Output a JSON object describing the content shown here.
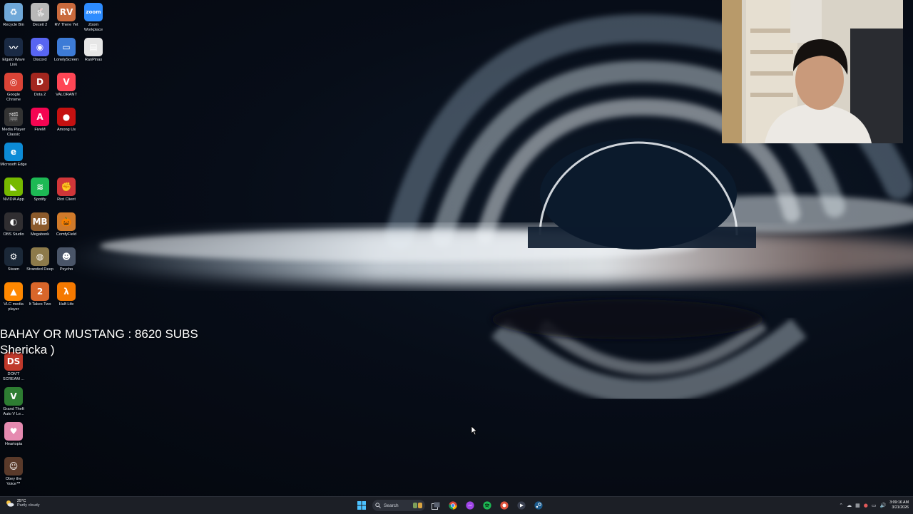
{
  "desktop": {
    "icons": [
      {
        "label": "Recycle Bin",
        "icon": "recycle-bin-icon",
        "color": "#6fa8d8",
        "glyph": "♻"
      },
      {
        "label": "Deceit 2",
        "icon": "deceit-icon",
        "color": "#b8b8b8",
        "glyph": "🐇"
      },
      {
        "label": "RV There Yet",
        "icon": "rv-there-yet-icon",
        "color": "#c96a3d",
        "glyph": "RV"
      },
      {
        "label": "Zoom Workplace",
        "icon": "zoom-icon",
        "color": "#2d8cff",
        "glyph": "zoom"
      },
      {
        "label": "Elgato Wave Link",
        "icon": "elgato-wave-link-icon",
        "color": "#1a2a44",
        "glyph": "〰"
      },
      {
        "label": "Discord",
        "icon": "discord-icon",
        "color": "#5865f2",
        "glyph": "◉"
      },
      {
        "label": "LonelyScreen",
        "icon": "lonelyscreen-icon",
        "color": "#3d7bd6",
        "glyph": "▭"
      },
      {
        "label": "RanPinas",
        "icon": "file-icon",
        "color": "#e6e6e6",
        "glyph": "▤"
      },
      {
        "label": "Google Chrome",
        "icon": "chrome-icon",
        "color": "#db4437",
        "glyph": "◎"
      },
      {
        "label": "Dota 2",
        "icon": "dota2-icon",
        "color": "#a3271f",
        "glyph": "D"
      },
      {
        "label": "VALORANT",
        "icon": "valorant-icon",
        "color": "#ff4655",
        "glyph": "V"
      },
      {
        "label": "Media Player Classic",
        "icon": "media-player-classic-icon",
        "color": "#333",
        "glyph": "🎬"
      },
      {
        "label": "FiveM",
        "icon": "fivem-icon",
        "color": "#f40552",
        "glyph": "A"
      },
      {
        "label": "Among Us",
        "icon": "among-us-icon",
        "color": "#c51111",
        "glyph": "●"
      },
      {
        "label": "Microsoft Edge",
        "icon": "edge-icon",
        "color": "#0c8bd6",
        "glyph": "e"
      },
      {
        "label": "NVIDIA App",
        "icon": "nvidia-icon",
        "color": "#76b900",
        "glyph": "◣"
      },
      {
        "label": "Spotify",
        "icon": "spotify-icon",
        "color": "#1db954",
        "glyph": "≋"
      },
      {
        "label": "Riot Client",
        "icon": "riot-client-icon",
        "color": "#d13639",
        "glyph": "✊"
      },
      {
        "label": "OBS Studio",
        "icon": "obs-icon",
        "color": "#302e31",
        "glyph": "◐"
      },
      {
        "label": "Megabonk",
        "icon": "megabonk-icon",
        "color": "#8b5a2b",
        "glyph": "MB"
      },
      {
        "label": "ComfyField",
        "icon": "comfyfield-icon",
        "color": "#d07a2a",
        "glyph": "🎃"
      },
      {
        "label": "Steam",
        "icon": "steam-icon",
        "color": "#1b2838",
        "glyph": "⚙"
      },
      {
        "label": "Stranded Deep",
        "icon": "stranded-deep-icon",
        "color": "#8d7a4a",
        "glyph": "◍"
      },
      {
        "label": "Psycho",
        "icon": "psycho-icon",
        "color": "#4a5568",
        "glyph": "☻"
      },
      {
        "label": "VLC media player",
        "icon": "vlc-icon",
        "color": "#ff8800",
        "glyph": "▲"
      },
      {
        "label": "It Takes Two",
        "icon": "it-takes-two-icon",
        "color": "#d9662a",
        "glyph": "2"
      },
      {
        "label": "Half-Life",
        "icon": "half-life-icon",
        "color": "#f57900",
        "glyph": "λ"
      },
      {
        "label": "DON'T SCREAM ...",
        "icon": "dont-scream-icon",
        "color": "#c0392b",
        "glyph": "DS"
      },
      {
        "label": "Grand Theft Auto V Le...",
        "icon": "gta5-icon",
        "color": "#2e7d32",
        "glyph": "V"
      },
      {
        "label": "Heartopia",
        "icon": "heartopia-icon",
        "color": "#e58ab0",
        "glyph": "♥"
      },
      {
        "label": "Obey the Voice™",
        "icon": "obey-the-voice-icon",
        "color": "#5a3a2a",
        "glyph": "☺"
      }
    ]
  },
  "overlay": {
    "line1": "BAHAY OR MUSTANG : 8620 SUBS",
    "line2": "Shericka )"
  },
  "taskbar": {
    "weather_temp": "25°C",
    "weather_condition": "Partly cloudy",
    "search_placeholder": "Search",
    "time": "3:09:16 AM",
    "date": "3/21/2026",
    "pinned": [
      "windows-start-icon",
      "task-view-icon",
      "chrome-icon",
      "messenger-icon",
      "spotify-icon",
      "game-icon",
      "media-icon",
      "steam-icon"
    ]
  }
}
